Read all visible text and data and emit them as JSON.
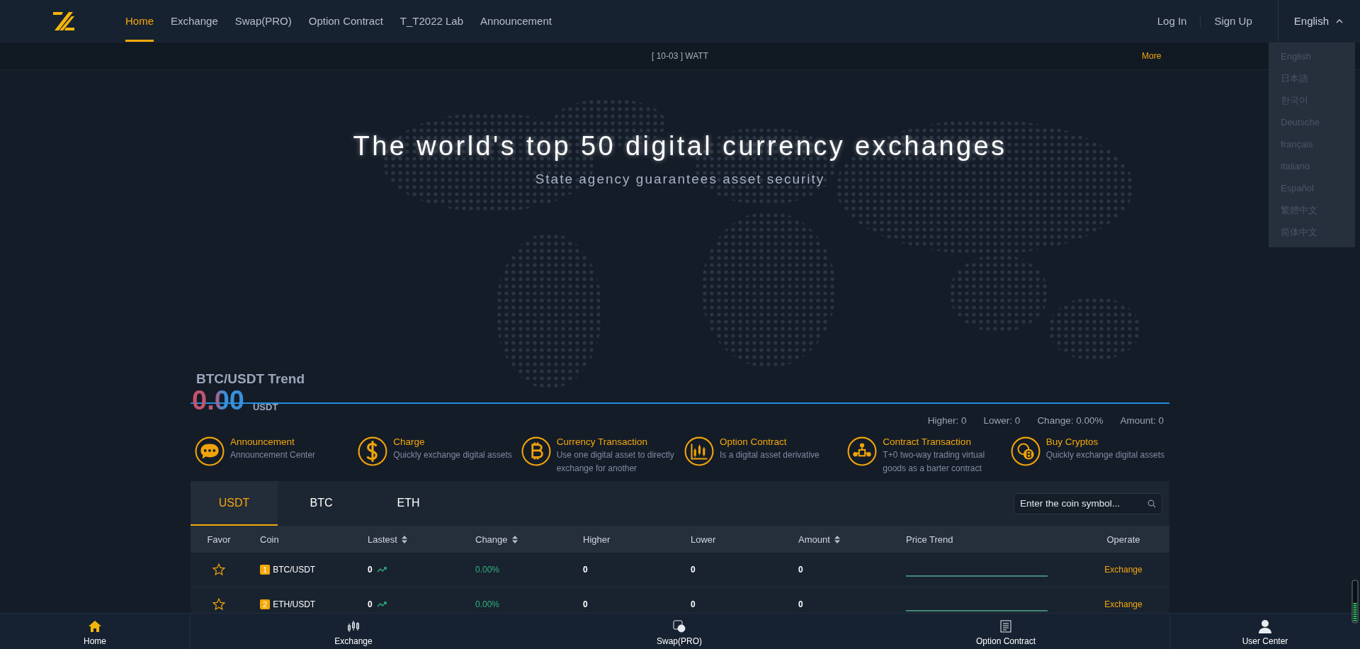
{
  "nav": {
    "items": [
      {
        "label": "Home",
        "selected": true
      },
      {
        "label": "Exchange",
        "selected": false
      },
      {
        "label": "Swap(PRO)",
        "selected": false
      },
      {
        "label": "Option Contract",
        "selected": false
      },
      {
        "label": "T_T2022 Lab",
        "selected": false
      },
      {
        "label": "Announcement",
        "selected": false
      }
    ],
    "auth": [
      "Log In",
      "Sign Up"
    ],
    "language": {
      "label": "English",
      "expanded": true
    },
    "language_menu": [
      "English",
      "日本語",
      "한국어",
      "Deutsche",
      "français",
      "italiano",
      "Español",
      "繁體中文",
      "简体中文"
    ]
  },
  "ticker": {
    "text": "[ 10-03 ] WATT",
    "more": "More"
  },
  "hero": {
    "title": "The world's top 50 digital currency exchanges",
    "subtitle": "State agency guarantees asset security"
  },
  "trend": {
    "title": "BTC/USDT Trend",
    "price": "0.00",
    "unit": "USDT",
    "stats": [
      "Higher: 0",
      "Lower: 0",
      "Change: 0.00%",
      "Amount: 0"
    ]
  },
  "features": [
    {
      "kind": "chat",
      "title": "Announcement",
      "desc": "Announcement Center"
    },
    {
      "kind": "dollar",
      "title": "Charge",
      "desc": "Quickly exchange digital assets"
    },
    {
      "kind": "bitcoin",
      "title": "Currency Transaction",
      "desc": "Use one digital asset to directly exchange for another"
    },
    {
      "kind": "chart",
      "title": "Option Contract",
      "desc": "Is a digital asset derivative"
    },
    {
      "kind": "network",
      "title": "Contract Transaction",
      "desc": "T+0 two-way trading virtual goods as a barter contract"
    },
    {
      "kind": "coin",
      "title": "Buy Cryptos",
      "desc": "Quickly exchange digital assets"
    }
  ],
  "market": {
    "tabs": [
      {
        "label": "USDT",
        "selected": true
      },
      {
        "label": "BTC",
        "selected": false
      },
      {
        "label": "ETH",
        "selected": false
      }
    ],
    "search": {
      "placeholder": "Enter the coin symbol..."
    },
    "columns": [
      {
        "label": "Favor",
        "sortable": false
      },
      {
        "label": "Coin",
        "sortable": false
      },
      {
        "label": "Lastest",
        "sortable": true
      },
      {
        "label": "Change",
        "sortable": true
      },
      {
        "label": "Higher",
        "sortable": false
      },
      {
        "label": "Lower",
        "sortable": false
      },
      {
        "label": "Amount",
        "sortable": true
      },
      {
        "label": "Price Trend",
        "sortable": false
      },
      {
        "label": "Operate",
        "sortable": false
      }
    ],
    "rows": [
      {
        "favorite": false,
        "rank": "1",
        "pair": "BTC/USDT",
        "last": "0",
        "change": "0.00%",
        "higher": "0",
        "lower": "0",
        "amount": "0",
        "operate": "Exchange"
      },
      {
        "favorite": false,
        "rank": "2",
        "pair": "ETH/USDT",
        "last": "0",
        "change": "0.00%",
        "higher": "0",
        "lower": "0",
        "amount": "0",
        "operate": "Exchange"
      }
    ]
  },
  "bottom_nav": [
    {
      "kind": "home",
      "label": "Home",
      "selected": true
    },
    {
      "kind": "candles",
      "label": "Exchange",
      "selected": false
    },
    {
      "kind": "swap",
      "label": "Swap(PRO)",
      "selected": false
    },
    {
      "kind": "document",
      "label": "Option Contract",
      "selected": false
    },
    {
      "kind": "user",
      "label": "User Center",
      "selected": false
    }
  ]
}
